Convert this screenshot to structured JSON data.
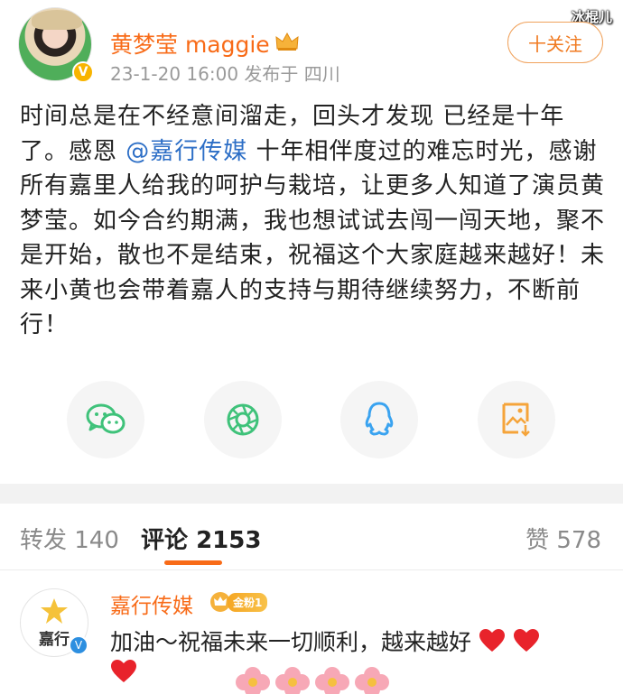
{
  "watermark": "冰棍儿",
  "post": {
    "user_name": "黄梦莹 maggie",
    "meta": "23-1-20 16:00  发布于 四川",
    "follow_label": "十关注",
    "content_part1": "时间总是在不经意间溜走，回头才发现 已经是十年了。感恩 ",
    "mention": "@嘉行传媒",
    "content_part2": " 十年相伴度过的难忘时光，感谢所有嘉里人给我的呵护与栽培，让更多人知道了演员黄梦莹。如今合约期满，我也想试试去闯一闯天地，聚不是开始，散也不是结束，祝福这个大家庭越来越好！未来小黄也会带着嘉人的支持与期待继续努力，不断前行！"
  },
  "share": {
    "icons": [
      "wechat-icon",
      "moments-icon",
      "qq-icon",
      "save-image-icon"
    ],
    "colors": {
      "green": "#3fc27a",
      "blue": "#3aa3f0",
      "orange": "#f5a43a"
    }
  },
  "tabs": {
    "repost": "转发 140",
    "comments_label": "评论",
    "comments_count": "2153",
    "likes": "赞 578"
  },
  "comment": {
    "avatar_text": "嘉行",
    "user_name": "嘉行传媒",
    "fan_badge": "金粉1",
    "text": "加油～祝福未来一切顺利，越来越好"
  },
  "colors": {
    "accent": "#f86b18",
    "mention": "#2c6ec6",
    "verify_gold": "#f8b400",
    "verify_blue": "#2d8fe0"
  }
}
